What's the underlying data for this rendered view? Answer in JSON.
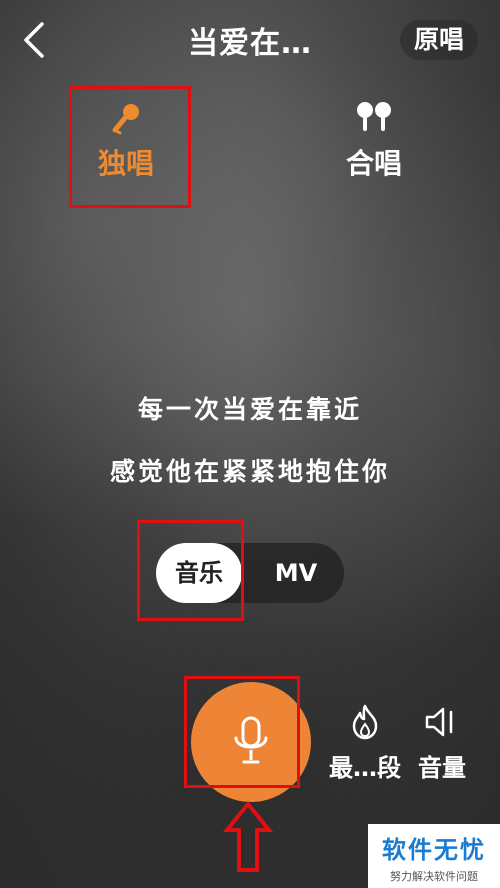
{
  "header": {
    "title": "当爱在…",
    "original_vocal_button": "原唱"
  },
  "modes": {
    "solo": {
      "label": "独唱",
      "icon": "microphone-icon",
      "active": true,
      "color": "#f08a2e"
    },
    "chorus": {
      "label": "合唱",
      "icon": "two-microphones-icon",
      "active": false
    }
  },
  "lyrics": {
    "line1": "每一次当爱在靠近",
    "line2": "感觉他在紧紧地抱住你"
  },
  "toggle": {
    "options": [
      "音乐",
      "MV"
    ],
    "selected": "音乐"
  },
  "bottom": {
    "record_button": {
      "icon": "microphone-icon",
      "color": "#ee8536"
    },
    "highlight_button": {
      "label": "最…段",
      "icon": "flame-icon"
    },
    "volume_button": {
      "label": "音量",
      "icon": "speaker-icon"
    }
  },
  "watermark": {
    "title": "软件无忧",
    "subtitle": "努力解决软件问题"
  },
  "annotation_color": "#e01010"
}
